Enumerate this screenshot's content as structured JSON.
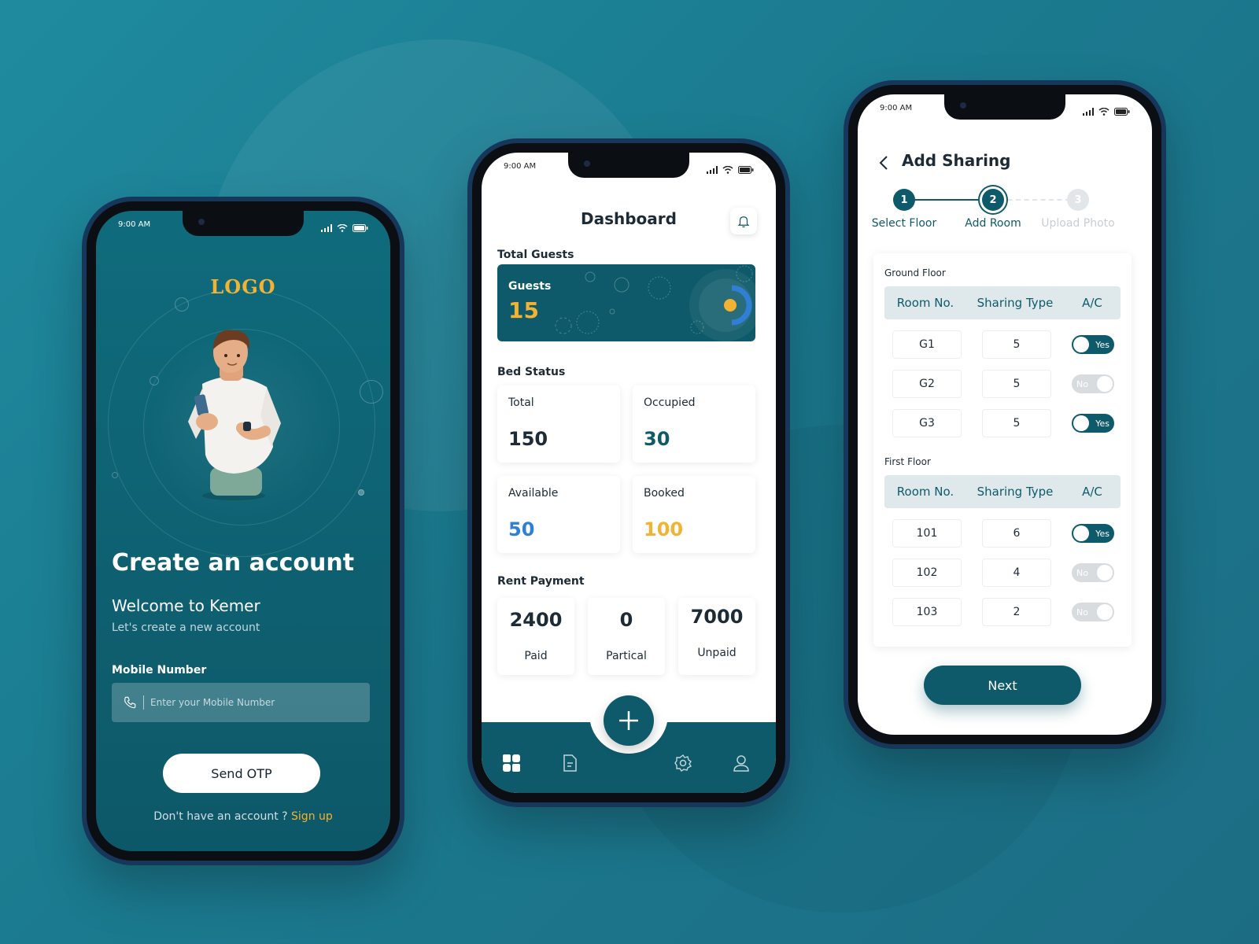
{
  "status_time": "9:00 AM",
  "signup_screen": {
    "logo": "LOGO",
    "title": "Create an account",
    "welcome": "Welcome to Kemer",
    "subtitle": "Let's create a new account",
    "mobile_label": "Mobile Number",
    "mobile_placeholder": "Enter your Mobile Number",
    "send_otp": "Send OTP",
    "no_account": "Don't have an account ?",
    "sign_up": "Sign up"
  },
  "dashboard": {
    "title": "Dashboard",
    "total_guests_label": "Total Guests",
    "guests_card": {
      "label": "Guests",
      "value": "15"
    },
    "bed_status_label": "Bed Status",
    "bed_status": [
      {
        "label": "Total",
        "value": "150",
        "color": "#1d2b36"
      },
      {
        "label": "Occupied",
        "value": "30",
        "color": "#0e5a6a"
      },
      {
        "label": "Available",
        "value": "50",
        "color": "#2f7fd6"
      },
      {
        "label": "Booked",
        "value": "100",
        "color": "#f2b233"
      }
    ],
    "rent_payment_label": "Rent Payment",
    "rent_payment": [
      {
        "value": "2400",
        "label": "Paid"
      },
      {
        "value": "0",
        "label": "Partical"
      },
      {
        "value": "7000",
        "label": "Unpaid"
      }
    ],
    "tabs": [
      "dashboard-icon",
      "document-icon",
      "settings-icon",
      "profile-icon"
    ]
  },
  "add_sharing": {
    "title": "Add Sharing",
    "steps": [
      {
        "num": "1",
        "label": "Select Floor",
        "state": "done"
      },
      {
        "num": "2",
        "label": "Add Room",
        "state": "current"
      },
      {
        "num": "3",
        "label": "Upload Photo",
        "state": "pending"
      }
    ],
    "columns": [
      "Room No.",
      "Sharing Type",
      "A/C"
    ],
    "floors": [
      {
        "name": "Ground Floor",
        "rooms": [
          {
            "room": "G1",
            "sharing": "5",
            "ac": "Yes"
          },
          {
            "room": "G2",
            "sharing": "5",
            "ac": "No"
          },
          {
            "room": "G3",
            "sharing": "5",
            "ac": "Yes"
          }
        ]
      },
      {
        "name": "First Floor",
        "rooms": [
          {
            "room": "101",
            "sharing": "6",
            "ac": "Yes"
          },
          {
            "room": "102",
            "sharing": "4",
            "ac": "No"
          },
          {
            "room": "103",
            "sharing": "2",
            "ac": "No"
          }
        ]
      }
    ],
    "next": "Next"
  },
  "colors": {
    "primary": "#0e5a6a",
    "accent": "#f2b233",
    "blue": "#2f7fd6"
  }
}
